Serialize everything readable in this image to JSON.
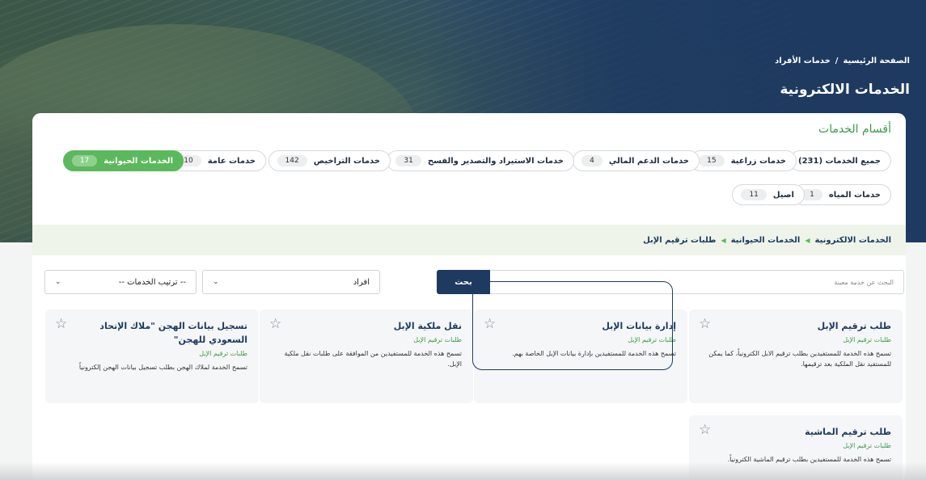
{
  "header": {
    "breadcrumb": [
      "الصفحة الرئيسية",
      "/",
      "خدمات الأفراد"
    ],
    "title": "الخدمات الالكترونية"
  },
  "categories": {
    "title": "أقسام الخدمات",
    "items": [
      {
        "label": "جميع الخدمات (231)",
        "count": ""
      },
      {
        "label": "خدمات زراعية",
        "count": "15"
      },
      {
        "label": "خدمات الدعم المالي",
        "count": "4"
      },
      {
        "label": "خدمات الاستيراد والتصدير والفسح",
        "count": "31"
      },
      {
        "label": "خدمات التراخيص",
        "count": "142"
      },
      {
        "label": "خدمات عامة",
        "count": "10"
      },
      {
        "label": "الخدمات الحيوانية",
        "count": "17"
      },
      {
        "label": "خدمات المياه",
        "count": "1"
      },
      {
        "label": "اصيل",
        "count": "11"
      }
    ]
  },
  "path": [
    "الخدمات الالكترونية",
    "الخدمات الحيوانية",
    "طلبات ترقيم الإبل"
  ],
  "search": {
    "placeholder": "البحث عن خدمة معينة",
    "button": "بحث",
    "type_select": "افراد",
    "sort_select": "-- ترتيب الخدمات --"
  },
  "cards": [
    {
      "title": "طلب ترقيم الإبل",
      "sub": "طلبات ترقيم الإبل",
      "desc": "تسمح هذه الخدمة للمستفيدين بطلب ترقيم الابل الكترونياً، كما يمكن للمستفيد نقل الملكية بعد ترقيمها."
    },
    {
      "title": "إدارة بيانات الإبل",
      "sub": "طلبات ترقيم الإبل",
      "desc": "تسمح هذه الخدمة للمستفيدين بإدارة بيانات الإبل الخاصة بهم."
    },
    {
      "title": "نقل ملكية الإبل",
      "sub": "طلبات ترقيم الإبل",
      "desc": "تسمح هذه الخدمة للمستفيدين من الموافقة على طلبات نقل ملكية الإبل."
    },
    {
      "title": "تسجيل بيانات الهجن \"ملاك الإتحاد السعودي للهجن\"",
      "sub": "طلبات ترقيم الإبل",
      "desc": "تسمح الخدمة لملاك الهجن بطلب تسجيل بيانات الهجن إلكترونياً"
    },
    {
      "title": "طلب ترقيم الماشية",
      "sub": "طلبات ترقيم الإبل",
      "desc": "تسمح هذه الخدمة للمستفيدين بطلب ترقيم الماشية الكترونياً."
    }
  ],
  "icons": {
    "favorite": "star-outline-icon",
    "chevron": "chevron-down-icon",
    "separator": "caret-left-icon"
  },
  "colors": {
    "primary": "#1e3a60",
    "accent_green": "#5cb85c",
    "section_title": "#3b9a4a"
  }
}
